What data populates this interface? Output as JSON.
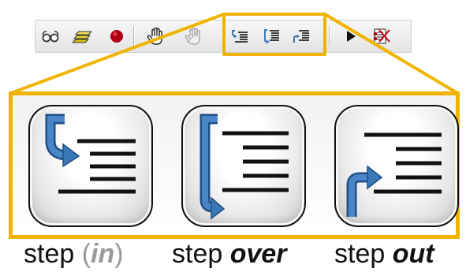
{
  "toolbar": {
    "buttons": [
      {
        "icon": "glasses-icon"
      },
      {
        "icon": "stacked-layers-icon"
      },
      {
        "icon": "record-dot-icon",
        "color": "#b00012"
      },
      {
        "icon": "hand-cursor-icon"
      },
      {
        "icon": "hand-disabled-icon"
      },
      {
        "icon": "step-in-icon"
      },
      {
        "icon": "step-over-icon"
      },
      {
        "icon": "step-out-icon"
      },
      {
        "icon": "play-icon"
      },
      {
        "icon": "clear-breakpoints-icon"
      }
    ]
  },
  "colors": {
    "highlight": "#f0b400",
    "arrow": "#3b78b6",
    "record": "#b00012"
  },
  "captions": {
    "step_in": {
      "word": "step",
      "paren_open": "(",
      "emphasis": "in",
      "paren_close": ")"
    },
    "step_over": {
      "word": "step",
      "emphasis": "over"
    },
    "step_out": {
      "word": "step",
      "emphasis": "out"
    }
  }
}
